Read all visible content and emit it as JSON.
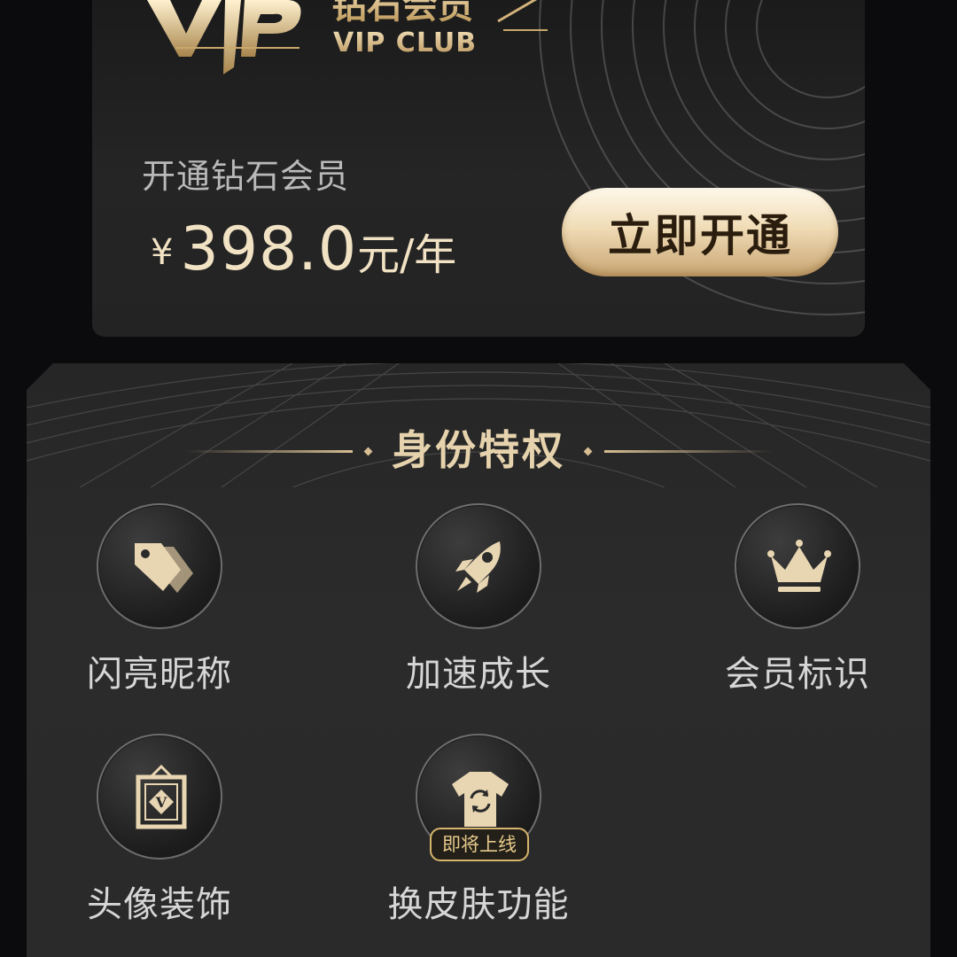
{
  "vip_card": {
    "logo_cn": "钻石会员",
    "logo_en": "VIP CLUB",
    "subtitle": "开通钻石会员",
    "price_symbol": "¥",
    "price_amount": "398.0",
    "price_unit": "元/年",
    "open_button_label": "立即开通"
  },
  "privileges": {
    "title": "身份特权",
    "items": [
      {
        "label": "闪亮昵称",
        "icon": "price-tag-icon"
      },
      {
        "label": "加速成长",
        "icon": "rocket-icon"
      },
      {
        "label": "会员标识",
        "icon": "crown-icon"
      },
      {
        "label": "头像装饰",
        "icon": "avatar-frame-icon"
      },
      {
        "label": "换皮肤功能",
        "icon": "shirt-swap-icon",
        "badge": "即将上线"
      }
    ]
  },
  "colors": {
    "gold": "#e6d3ad",
    "button_gold": "#f0dcb6",
    "background": "#0b0b0d",
    "panel": "#2a2a2a"
  }
}
